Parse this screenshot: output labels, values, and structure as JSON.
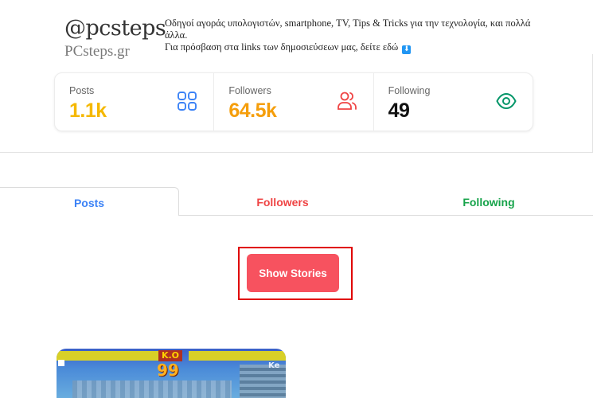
{
  "profile": {
    "username": "@pcsteps",
    "full_name": "PCsteps.gr",
    "bio_line1": "Οδηγοί αγοράς υπολογιστών, smartphone, TV, Tips & Tricks για την τεχνολογία, και πολλά άλλα.",
    "bio_line2": "Για πρόσβαση στα links των δημοσιεύσεων μας, δείτε εδώ",
    "bio_emoji": "⬇"
  },
  "stats": [
    {
      "label": "Posts",
      "value": "1.1k",
      "icon": "grid-icon",
      "color": "#f5b800",
      "icon_color": "#3b82f6"
    },
    {
      "label": "Followers",
      "value": "64.5k",
      "icon": "users-icon",
      "color": "#f59e0b",
      "icon_color": "#ef4444"
    },
    {
      "label": "Following",
      "value": "49",
      "icon": "eye-icon",
      "color": "#111111",
      "icon_color": "#059669"
    }
  ],
  "tabs": [
    {
      "label": "Posts",
      "color": "#3b82f6",
      "active": true
    },
    {
      "label": "Followers",
      "color": "#ef4444",
      "active": false
    },
    {
      "label": "Following",
      "color": "#16a34a",
      "active": false
    }
  ],
  "stories_button": {
    "label": "Show Stories",
    "color": "#f7525f"
  },
  "post_thumbnail": {
    "ko_text": "K.O",
    "timer": "99",
    "player_tag": "Ke"
  }
}
